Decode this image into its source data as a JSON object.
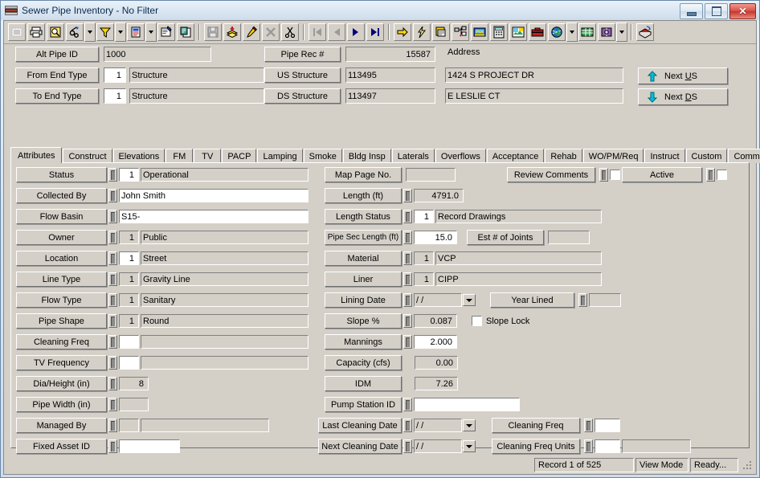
{
  "window": {
    "title": "Sewer Pipe Inventory - No Filter",
    "icon": "pipe-stack-icon",
    "controls": {
      "minimize": "minimize-icon",
      "maximize": "maximize-icon",
      "close": "close-icon"
    }
  },
  "toolbar": {
    "buttons": [
      {
        "name": "select-icon",
        "enabled": false
      },
      {
        "name": "print-icon",
        "enabled": true
      },
      {
        "name": "print-preview-icon",
        "enabled": true
      },
      {
        "name": "find-icon",
        "enabled": true
      },
      {
        "name": "find-dropdown-icon",
        "enabled": true
      },
      {
        "name": "filter-icon",
        "enabled": true
      },
      {
        "name": "filter-dropdown-icon",
        "enabled": true
      },
      {
        "name": "report-icon",
        "enabled": true
      },
      {
        "name": "report-dropdown-icon",
        "enabled": true
      },
      {
        "name": "properties-icon",
        "enabled": true
      },
      {
        "name": "copy-record-icon",
        "enabled": true
      },
      {
        "name": "save-icon",
        "enabled": false
      },
      {
        "name": "add-record-icon",
        "enabled": true
      },
      {
        "name": "edit-record-icon",
        "enabled": true
      },
      {
        "name": "delete-record-icon",
        "enabled": false
      },
      {
        "name": "cut-icon",
        "enabled": true
      },
      {
        "name": "first-record-icon",
        "enabled": false
      },
      {
        "name": "previous-record-icon",
        "enabled": false
      },
      {
        "name": "next-record-icon",
        "enabled": true
      },
      {
        "name": "last-record-icon",
        "enabled": true
      },
      {
        "name": "goto-icon",
        "enabled": true
      },
      {
        "name": "quick-action-icon",
        "enabled": true
      },
      {
        "name": "layers-icon",
        "enabled": true
      },
      {
        "name": "tree-view-icon",
        "enabled": true
      },
      {
        "name": "map-icon",
        "enabled": true
      },
      {
        "name": "calculator-icon",
        "enabled": true
      },
      {
        "name": "photo-icon",
        "enabled": true
      },
      {
        "name": "toolbox-icon",
        "enabled": true
      },
      {
        "name": "globe-icon",
        "enabled": true
      },
      {
        "name": "globe-dropdown-icon",
        "enabled": true
      },
      {
        "name": "spreadsheet-icon",
        "enabled": true
      },
      {
        "name": "help-book-icon",
        "enabled": true
      },
      {
        "name": "help-dropdown-icon",
        "enabled": true
      },
      {
        "name": "exit-icon",
        "enabled": true
      }
    ]
  },
  "header": {
    "address_label": "Address",
    "left": [
      {
        "label": "Alt Pipe ID",
        "value": "1000",
        "code": null,
        "white": false,
        "has_lookup": false
      },
      {
        "label": "From End Type",
        "value": "Structure",
        "code": "1",
        "white": false,
        "has_lookup": false
      },
      {
        "label": "To End Type",
        "value": "Structure",
        "code": "1",
        "white": false,
        "has_lookup": false
      }
    ],
    "mid": [
      {
        "label": "Pipe Rec #",
        "value": "15587",
        "numeric": true
      },
      {
        "label": "US Structure",
        "value": "113495",
        "numeric": false
      },
      {
        "label": "DS Structure",
        "value": "113497",
        "numeric": false
      }
    ],
    "address": [
      "",
      "1424  S  PROJECT DR",
      "E  LESLIE CT"
    ],
    "nav": [
      {
        "label": "Next US",
        "underline_index": 5,
        "arrow": "up-arrow-icon",
        "name": "next-us-button"
      },
      {
        "label": "Next DS",
        "underline_index": 5,
        "arrow": "down-arrow-icon",
        "name": "next-ds-button"
      }
    ]
  },
  "tabs": {
    "items": [
      "Attributes",
      "Construct",
      "Elevations",
      "FM",
      "TV",
      "PACP",
      "Lamping",
      "Smoke",
      "Bldg Insp",
      "Laterals",
      "Overflows",
      "Acceptance",
      "Rehab",
      "WO/PM/Req",
      "Instruct",
      "Custom",
      "Comments"
    ],
    "active": "Attributes"
  },
  "attributes": {
    "left_fields": [
      {
        "label": "Status",
        "code": "1",
        "code_white": true,
        "value": "Operational",
        "value_white": false,
        "has_code": true,
        "has_value": true
      },
      {
        "label": "Collected By",
        "code": null,
        "code_white": false,
        "value": "John Smith",
        "value_white": true,
        "has_code": false,
        "has_value": true
      },
      {
        "label": "Flow Basin",
        "code": null,
        "code_white": false,
        "value": "S15-",
        "value_white": true,
        "has_code": false,
        "has_value": true
      },
      {
        "label": "Owner",
        "code": "1",
        "code_white": false,
        "value": "Public",
        "value_white": false,
        "has_code": true,
        "has_value": true
      },
      {
        "label": "Location",
        "code": "1",
        "code_white": true,
        "value": "Street",
        "value_white": false,
        "has_code": true,
        "has_value": true
      },
      {
        "label": "Line Type",
        "code": "1",
        "code_white": false,
        "value": "Gravity Line",
        "value_white": false,
        "has_code": true,
        "has_value": true
      },
      {
        "label": "Flow Type",
        "code": "1",
        "code_white": false,
        "value": "Sanitary",
        "value_white": false,
        "has_code": true,
        "has_value": true
      },
      {
        "label": "Pipe Shape",
        "code": "1",
        "code_white": false,
        "value": "Round",
        "value_white": false,
        "has_code": true,
        "has_value": true
      },
      {
        "label": "Cleaning Freq",
        "code": "",
        "code_white": true,
        "value": "",
        "value_white": false,
        "has_code": true,
        "has_value": true
      },
      {
        "label": "TV Frequency",
        "code": "",
        "code_white": true,
        "value": "",
        "value_white": false,
        "has_code": true,
        "has_value": true
      },
      {
        "label": "Dia/Height (in)",
        "code": "8",
        "code_white": false,
        "value": null,
        "value_white": false,
        "has_code": true,
        "has_value": false
      },
      {
        "label": "Pipe Width (in)",
        "code": "",
        "code_white": false,
        "value": null,
        "value_white": false,
        "has_code": true,
        "has_value": false
      },
      {
        "label": "Managed By",
        "code": "",
        "code_white": false,
        "value": "",
        "value_white": false,
        "has_code": true,
        "has_value": true
      },
      {
        "label": "Fixed Asset ID",
        "code": "",
        "code_white": true,
        "value": null,
        "value_white": false,
        "has_code": true,
        "has_value": false
      }
    ],
    "mid_fields": [
      {
        "label": "Map Page No.",
        "code": null,
        "value": null,
        "numeric_value": "",
        "has_lookup": false
      },
      {
        "label": "Length (ft)",
        "code": null,
        "value": null,
        "numeric_value": "4791.0",
        "has_lookup": true
      },
      {
        "label": "Length Status",
        "code": "1",
        "value": "Record Drawings",
        "numeric_value": null,
        "has_lookup": true,
        "code_white": true
      },
      {
        "label": "Pipe Sec Length (ft)",
        "code": "15.0",
        "value": null,
        "numeric_value": null,
        "has_lookup": true,
        "code_white": true,
        "code_numeric": true
      },
      {
        "label": "Material",
        "code": "1",
        "value": "VCP",
        "numeric_value": null,
        "has_lookup": true
      },
      {
        "label": "Liner",
        "code": "1",
        "value": "CIPP",
        "numeric_value": null,
        "has_lookup": true
      },
      {
        "label": "Lining Date",
        "code": null,
        "value": null,
        "date_value": "/  /",
        "has_lookup": true
      },
      {
        "label": "Slope %",
        "code": null,
        "value": null,
        "numeric_value": "0.087",
        "has_lookup": true
      },
      {
        "label": "Mannings",
        "code": null,
        "value": null,
        "numeric_value": "2.000",
        "has_lookup": true,
        "value_white": true
      },
      {
        "label": "Capacity (cfs)",
        "code": null,
        "value": null,
        "numeric_value": "0.00",
        "has_lookup": false
      },
      {
        "label": "IDM",
        "code": null,
        "value": null,
        "numeric_value": "7.26",
        "has_lookup": false
      },
      {
        "label": "Pump Station ID",
        "code": null,
        "value": "",
        "numeric_value": null,
        "has_lookup": true,
        "value_white": true
      },
      {
        "label": "Last Cleaning Date",
        "code": null,
        "value": null,
        "date_value": "/  /",
        "has_lookup": true
      },
      {
        "label": "Next Cleaning Date",
        "code": null,
        "value": null,
        "date_value": "/  /",
        "has_lookup": true
      }
    ],
    "right_controls": {
      "review_comments": {
        "label": "Review Comments",
        "checked": false
      },
      "active": {
        "label": "Active",
        "checked": false
      },
      "est_joints": {
        "label": "Est # of Joints",
        "value": ""
      },
      "year_lined": {
        "label": "Year Lined",
        "value": ""
      },
      "slope_lock": {
        "label": "Slope Lock",
        "checked": false
      },
      "cleaning_freq": {
        "label": "Cleaning Freq",
        "value": ""
      },
      "cleaning_freq_units": {
        "label": "Cleaning Freq Units",
        "code": "",
        "value": ""
      }
    }
  },
  "status_bar": {
    "record": "Record 1 of 525",
    "mode": "View Mode",
    "state": "Ready..."
  },
  "colors": {
    "face": "#d4d0c8",
    "title_text": "#0d2a4a",
    "close_red": "#c3362c",
    "arrow_cyan": "#00b0c0",
    "nav_blue": "#000080"
  }
}
